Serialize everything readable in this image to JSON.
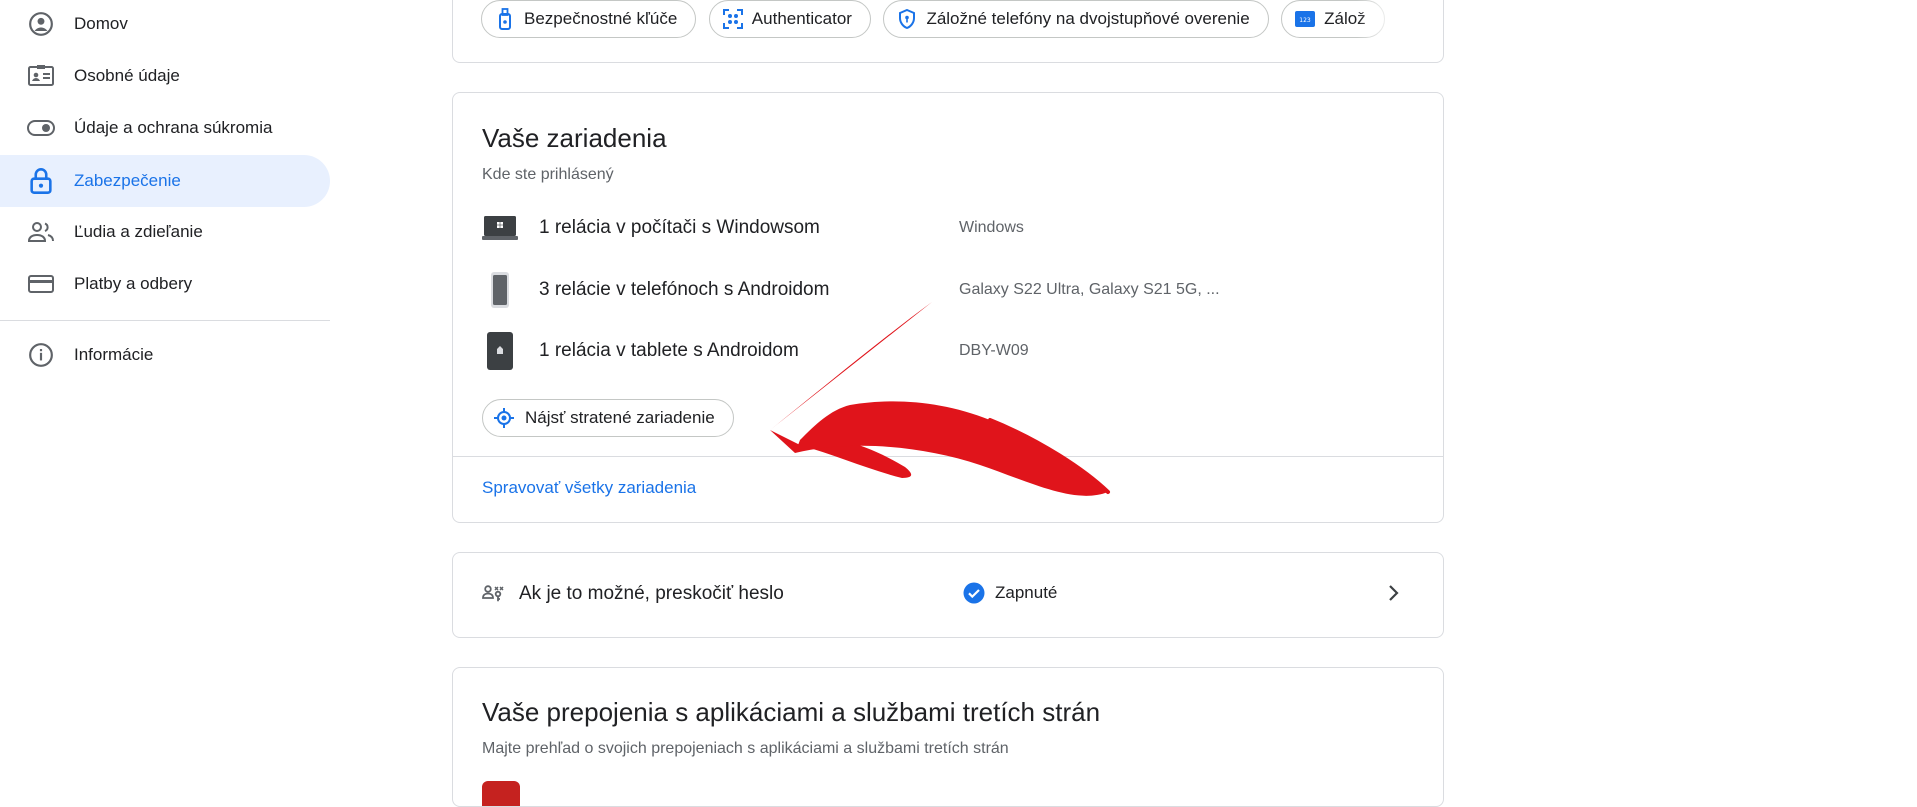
{
  "sidebar": {
    "items": [
      {
        "label": "Domov",
        "icon": "account-circle-icon"
      },
      {
        "label": "Osobné údaje",
        "icon": "id-card-icon"
      },
      {
        "label": "Údaje a ochrana súkromia",
        "icon": "toggle-icon"
      },
      {
        "label": "Zabezpečenie",
        "icon": "lock-icon",
        "active": true
      },
      {
        "label": "Ľudia a zdieľanie",
        "icon": "people-icon"
      },
      {
        "label": "Platby a odbery",
        "icon": "credit-card-icon"
      },
      {
        "label": "Informácie",
        "icon": "info-icon"
      }
    ]
  },
  "signin_methods": {
    "chips": [
      {
        "label": "Bezpečnostné kľúče",
        "icon": "security-key-icon"
      },
      {
        "label": "Authenticator",
        "icon": "authenticator-icon"
      },
      {
        "label": "Záložné telefóny na dvojstupňové overenie",
        "icon": "shield-icon"
      },
      {
        "label": "Zálož",
        "icon": "backup-codes-icon"
      }
    ]
  },
  "devices": {
    "title": "Vaše zariadenia",
    "subtitle": "Kde ste prihlásený",
    "rows": [
      {
        "title": "1 relácia v počítači s Windowsom",
        "detail": "Windows",
        "icon": "windows-laptop-icon"
      },
      {
        "title": "3 relácie v telefónoch s Androidom",
        "detail": "Galaxy S22 Ultra, Galaxy S21 5G, ...",
        "icon": "phone-icon"
      },
      {
        "title": "1 relácia v tablete s Androidom",
        "detail": "DBY-W09",
        "icon": "tablet-icon"
      }
    ],
    "find_button": "Nájsť stratené zariadenie",
    "manage_link": "Spravovať všetky zariadenia"
  },
  "passkey": {
    "label": "Ak je to možné, preskočiť heslo",
    "status": "Zapnuté"
  },
  "third_party": {
    "title": "Vaše prepojenia s aplikáciami a službami tretích strán",
    "subtitle": "Majte prehľad o svojich prepojeniach s aplikáciami a službami tretích strán"
  },
  "colors": {
    "accent": "#1a73e8",
    "active_bg": "#e8f0fe",
    "arrow": "#e0141b"
  }
}
